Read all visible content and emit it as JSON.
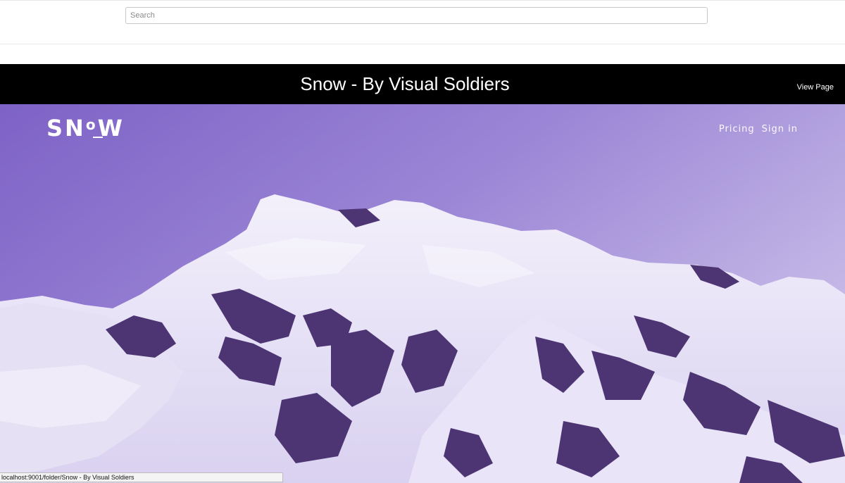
{
  "search": {
    "placeholder": "Search",
    "value": ""
  },
  "preview": {
    "title": "Snow - By Visual Soldiers",
    "view_page_label": "View Page"
  },
  "site": {
    "logo_text": "SNoW",
    "logo_parts": [
      "SN",
      "o",
      "W"
    ],
    "nav": [
      {
        "label": "Pricing"
      },
      {
        "label": "Sign in"
      }
    ]
  },
  "status_bar": {
    "url": "localhost:9001/folder/Snow - By Visual Soldiers"
  },
  "colors": {
    "title_bar_bg": "#000000",
    "hero_tint": "#7b5cc4",
    "snow": "#eeeaf8",
    "rock": "#4b3570"
  }
}
